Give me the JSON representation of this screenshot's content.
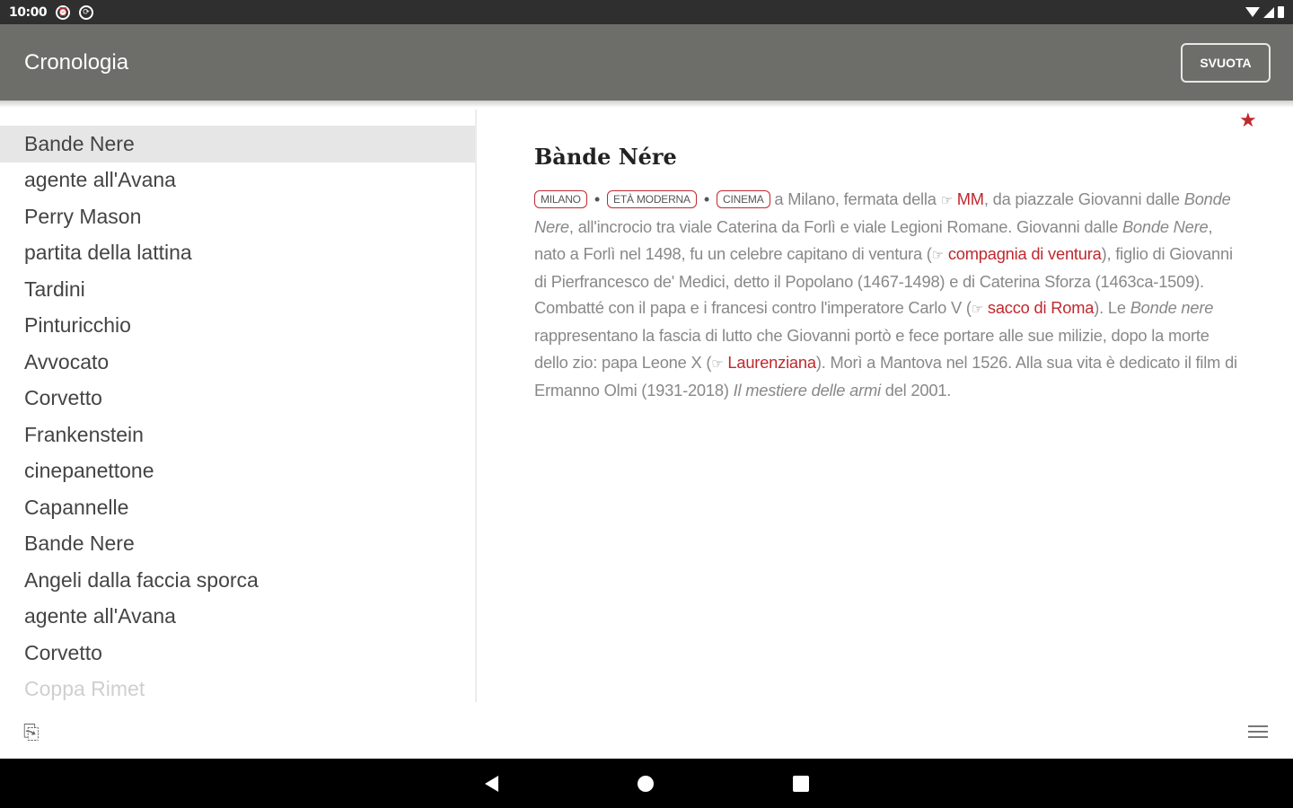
{
  "status_bar": {
    "time": "10:00",
    "icons": [
      "alarm-icon",
      "sync-icon"
    ]
  },
  "app_bar": {
    "title": "Cronologia",
    "clear_label": "SVUOTA"
  },
  "history": [
    {
      "label": "Bande Nere",
      "selected": true
    },
    {
      "label": "agente all'Avana"
    },
    {
      "label": "Perry Mason"
    },
    {
      "label": "partita della lattina"
    },
    {
      "label": "Tardini"
    },
    {
      "label": "Pinturicchio"
    },
    {
      "label": "Avvocato"
    },
    {
      "label": "Corvetto"
    },
    {
      "label": "Frankenstein"
    },
    {
      "label": "cinepanettone"
    },
    {
      "label": "Capannelle"
    },
    {
      "label": "Bande Nere"
    },
    {
      "label": "Angeli dalla faccia sporca"
    },
    {
      "label": "agente all'Avana"
    },
    {
      "label": "Corvetto"
    },
    {
      "label": "Coppa Rimet"
    }
  ],
  "entry": {
    "title": "Bànde Nére",
    "tags": [
      "MILANO",
      "ETÀ MODERNA",
      "CINEMA"
    ],
    "body": {
      "p1": "a Milano, fermata della",
      "ref1": "MM",
      "p2": ", da piazzale Giovanni dalle",
      "it1": "Bonde Nere",
      "p3": ", all'incrocio tra viale Caterina da Forlì e viale Legioni Romane. Giovanni dalle",
      "it2": "Bonde Nere",
      "p4": ", nato a Forlì nel 1498, fu un celebre capitano di ventura (",
      "ref2": "compagnia di ventura",
      "p5": "), figlio di Giovanni di Pierfrancesco de' Medici, detto il Popolano (1467-1498) e di Caterina Sforza (1463ca-1509). Combatté con il papa e i francesi contro l'imperatore Carlo V (",
      "ref3": "sacco di Roma",
      "p6": "). Le",
      "it3": "Bonde nere",
      "p7": "rappresentano la fascia di lutto che Giovanni portò e fece portare alle sue milizie, dopo la morte dello zio: papa Leone X (",
      "ref4": "Laurenziana",
      "p8": "). Morì a Mantova nel 1526. Alla sua vita è dedicato il film di Ermanno Olmi (1931-2018)",
      "it4": "Il mestiere delle armi",
      "p9": "del 2001."
    }
  },
  "colors": {
    "app_bar": "#6d6e69",
    "accent": "#c0282d"
  }
}
